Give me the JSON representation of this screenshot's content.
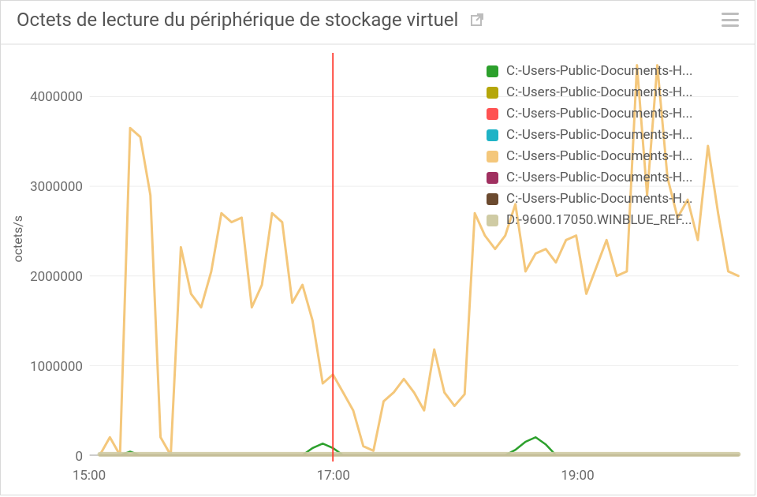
{
  "header": {
    "title": "Octets de lecture du périphérique de stockage virtuel"
  },
  "axes": {
    "ylabel": "octets/s",
    "yticks": [
      "0",
      "1000000",
      "2000000",
      "3000000",
      "4000000"
    ],
    "xticks": [
      "15:00",
      "17:00",
      "19:00"
    ]
  },
  "legend": [
    {
      "color": "#2ca02c",
      "label": "C:-Users-Public-Documents-H..."
    },
    {
      "color": "#b5a60a",
      "label": "C:-Users-Public-Documents-H..."
    },
    {
      "color": "#ff5252",
      "label": "C:-Users-Public-Documents-H..."
    },
    {
      "color": "#1fb3c6",
      "label": "C:-Users-Public-Documents-H..."
    },
    {
      "color": "#f4c77b",
      "label": "C:-Users-Public-Documents-H..."
    },
    {
      "color": "#a03060",
      "label": "C:-Users-Public-Documents-H..."
    },
    {
      "color": "#6b4a2f",
      "label": "C:-Users-Public-Documents-H..."
    },
    {
      "color": "#cfcba4",
      "label": "D:-9600.17050.WINBLUE_REF..."
    }
  ],
  "annotation": {
    "x": "17:00"
  },
  "chart_data": {
    "type": "line",
    "xlabel": "",
    "ylabel": "octets/s",
    "title": "Octets de lecture du périphérique de stockage virtuel",
    "xlim": [
      "15:00",
      "20:20"
    ],
    "ylim": [
      0,
      4400000
    ],
    "x": [
      "15:05",
      "15:10",
      "15:15",
      "15:20",
      "15:25",
      "15:30",
      "15:35",
      "15:40",
      "15:45",
      "15:50",
      "15:55",
      "16:00",
      "16:05",
      "16:10",
      "16:15",
      "16:20",
      "16:25",
      "16:30",
      "16:35",
      "16:40",
      "16:45",
      "16:50",
      "16:55",
      "17:00",
      "17:05",
      "17:10",
      "17:15",
      "17:20",
      "17:25",
      "17:30",
      "17:35",
      "17:40",
      "17:45",
      "17:50",
      "17:55",
      "18:00",
      "18:05",
      "18:10",
      "18:15",
      "18:20",
      "18:25",
      "18:30",
      "18:35",
      "18:40",
      "18:45",
      "18:50",
      "18:55",
      "19:00",
      "19:05",
      "19:10",
      "19:15",
      "19:20",
      "19:25",
      "19:30",
      "19:35",
      "19:40",
      "19:45",
      "19:50",
      "19:55",
      "20:00",
      "20:05",
      "20:10",
      "20:15",
      "20:20"
    ],
    "series": [
      {
        "name": "C:-Users-Public-Documents-H... (green)",
        "color": "#2ca02c",
        "values": [
          0,
          0,
          0,
          40000,
          0,
          0,
          0,
          0,
          0,
          0,
          0,
          0,
          0,
          0,
          0,
          0,
          0,
          0,
          0,
          0,
          0,
          80000,
          130000,
          80000,
          0,
          0,
          0,
          0,
          0,
          0,
          0,
          0,
          0,
          0,
          0,
          0,
          0,
          0,
          0,
          0,
          0,
          60000,
          150000,
          200000,
          120000,
          0,
          0,
          0,
          0,
          0,
          0,
          0,
          0,
          0,
          0,
          0,
          0,
          0,
          0,
          0,
          0,
          0,
          0,
          0
        ]
      },
      {
        "name": "C:-Users-Public-Documents-H... (olive)",
        "color": "#b5a60a",
        "values": [
          0,
          0,
          0,
          0,
          0,
          0,
          0,
          0,
          0,
          0,
          0,
          0,
          0,
          0,
          0,
          0,
          0,
          0,
          0,
          0,
          0,
          0,
          0,
          0,
          0,
          0,
          0,
          0,
          0,
          0,
          0,
          0,
          0,
          0,
          0,
          0,
          0,
          0,
          0,
          0,
          0,
          0,
          0,
          0,
          0,
          0,
          0,
          0,
          0,
          0,
          0,
          0,
          0,
          0,
          0,
          0,
          0,
          0,
          0,
          0,
          0,
          0,
          0,
          0
        ]
      },
      {
        "name": "C:-Users-Public-Documents-H... (red)",
        "color": "#ff5252",
        "values": [
          0,
          0,
          0,
          0,
          0,
          0,
          0,
          0,
          0,
          0,
          0,
          0,
          0,
          0,
          0,
          0,
          0,
          0,
          0,
          0,
          0,
          0,
          0,
          0,
          0,
          0,
          0,
          0,
          0,
          0,
          0,
          0,
          0,
          0,
          0,
          0,
          0,
          0,
          0,
          0,
          0,
          0,
          0,
          0,
          0,
          0,
          0,
          0,
          0,
          0,
          0,
          0,
          0,
          0,
          0,
          0,
          0,
          0,
          0,
          0,
          0,
          0,
          0,
          0
        ]
      },
      {
        "name": "C:-Users-Public-Documents-H... (teal)",
        "color": "#1fb3c6",
        "values": [
          0,
          0,
          0,
          0,
          0,
          0,
          0,
          0,
          0,
          0,
          0,
          0,
          0,
          0,
          0,
          0,
          0,
          0,
          0,
          0,
          0,
          0,
          0,
          0,
          0,
          0,
          0,
          0,
          0,
          0,
          0,
          0,
          0,
          0,
          0,
          0,
          0,
          0,
          0,
          0,
          0,
          0,
          0,
          0,
          0,
          0,
          0,
          0,
          0,
          0,
          0,
          0,
          0,
          0,
          0,
          0,
          0,
          0,
          0,
          0,
          0,
          0,
          0,
          0
        ]
      },
      {
        "name": "C:-Users-Public-Documents-H... (orange, primary)",
        "color": "#f4c77b",
        "values": [
          0,
          200000,
          0,
          3650000,
          3550000,
          2900000,
          200000,
          0,
          2320000,
          1800000,
          1650000,
          2050000,
          2700000,
          2600000,
          2650000,
          1650000,
          1900000,
          2700000,
          2600000,
          1700000,
          1900000,
          1500000,
          800000,
          900000,
          700000,
          500000,
          100000,
          50000,
          600000,
          700000,
          850000,
          700000,
          500000,
          1180000,
          700000,
          550000,
          680000,
          2700000,
          2450000,
          2300000,
          2450000,
          2800000,
          2050000,
          2250000,
          2300000,
          2150000,
          2400000,
          2450000,
          1800000,
          2100000,
          2400000,
          2000000,
          2050000,
          4350000,
          2900000,
          4350000,
          3100000,
          2650000,
          2850000,
          2400000,
          3450000,
          2700000,
          2050000,
          2000000
        ]
      },
      {
        "name": "C:-Users-Public-Documents-H... (maroon)",
        "color": "#a03060",
        "values": [
          0,
          0,
          0,
          0,
          0,
          0,
          0,
          0,
          0,
          0,
          0,
          0,
          0,
          0,
          0,
          0,
          0,
          0,
          0,
          0,
          0,
          0,
          0,
          0,
          0,
          0,
          0,
          0,
          0,
          0,
          0,
          0,
          0,
          0,
          0,
          0,
          0,
          0,
          0,
          0,
          0,
          0,
          0,
          0,
          0,
          0,
          0,
          0,
          0,
          0,
          0,
          0,
          0,
          0,
          0,
          0,
          0,
          0,
          0,
          0,
          0,
          0,
          0,
          0
        ]
      },
      {
        "name": "C:-Users-Public-Documents-H... (brown)",
        "color": "#6b4a2f",
        "values": [
          0,
          0,
          0,
          0,
          0,
          0,
          0,
          0,
          0,
          0,
          0,
          0,
          0,
          0,
          0,
          0,
          0,
          0,
          0,
          0,
          0,
          0,
          0,
          0,
          0,
          0,
          0,
          0,
          0,
          0,
          0,
          0,
          0,
          0,
          0,
          0,
          0,
          0,
          0,
          0,
          0,
          0,
          0,
          0,
          0,
          0,
          0,
          0,
          0,
          0,
          0,
          0,
          0,
          0,
          0,
          0,
          0,
          0,
          0,
          0,
          0,
          0,
          0,
          0
        ]
      },
      {
        "name": "D:-9600.17050.WINBLUE_REF...",
        "color": "#cfcba4",
        "values": [
          10000,
          10000,
          10000,
          10000,
          10000,
          10000,
          10000,
          10000,
          10000,
          10000,
          10000,
          10000,
          10000,
          10000,
          10000,
          10000,
          10000,
          10000,
          10000,
          10000,
          10000,
          10000,
          10000,
          10000,
          10000,
          10000,
          10000,
          10000,
          10000,
          10000,
          10000,
          10000,
          10000,
          10000,
          10000,
          10000,
          10000,
          10000,
          10000,
          10000,
          10000,
          10000,
          10000,
          10000,
          10000,
          10000,
          10000,
          10000,
          10000,
          10000,
          10000,
          10000,
          10000,
          10000,
          10000,
          10000,
          10000,
          10000,
          10000,
          10000,
          10000,
          10000,
          10000,
          10000
        ]
      }
    ],
    "annotations": [
      {
        "x": "17:00",
        "kind": "vertical-line",
        "color": "#ff3b30"
      }
    ]
  }
}
